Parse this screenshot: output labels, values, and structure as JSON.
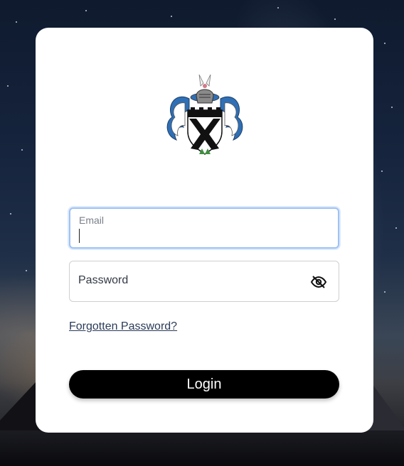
{
  "login_form": {
    "crest_icon": "coat-of-arms-logo",
    "email_label": "Email",
    "email_value": "",
    "password_placeholder": "Password",
    "password_visibility_icon": "eye-slash-icon",
    "forgot_password_label": "Forgotten Password?",
    "login_button_label": "Login"
  },
  "colors": {
    "card_background": "#ffffff",
    "focus_border": "#9fc2f4",
    "button_background": "#000000",
    "link_color": "#2b3b58"
  }
}
